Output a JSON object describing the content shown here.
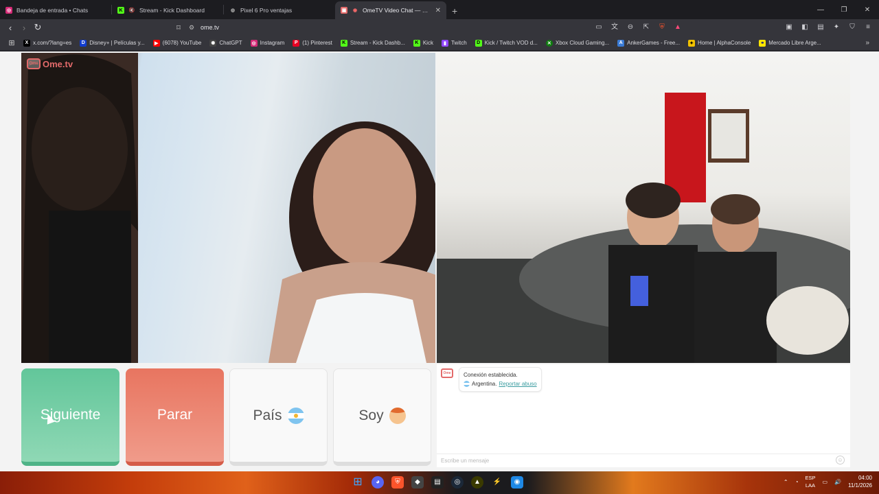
{
  "browser": {
    "tabs": [
      {
        "title": "Bandeja de entrada • Chats",
        "icon": "instagram-icon",
        "color": "#d62976",
        "active": false
      },
      {
        "title": "Stream - Kick Dashboard",
        "icon": "kick-icon",
        "color": "#53fc18",
        "active": false
      },
      {
        "title": "Pixel 6 Pro ventajas",
        "icon": "globe-icon",
        "color": "#888888",
        "active": false
      },
      {
        "title": "OmeTV Video Chat — Omeg",
        "icon": "ometv-icon",
        "color": "#e36a6a",
        "active": true
      }
    ],
    "url": "ome.tv",
    "bookmarks": [
      {
        "label": "x.com/?lang=es",
        "icon": "x-icon",
        "color": "#000000"
      },
      {
        "label": "Disney+ | Películas y...",
        "icon": "disney-icon",
        "color": "#113ccf"
      },
      {
        "label": "(6078) YouTube",
        "icon": "youtube-icon",
        "color": "#ff0000"
      },
      {
        "label": "ChatGPT",
        "icon": "chatgpt-icon",
        "color": "#444444"
      },
      {
        "label": "Instagram",
        "icon": "instagram-icon",
        "color": "#d62976"
      },
      {
        "label": "(1) Pinterest",
        "icon": "pinterest-icon",
        "color": "#e60023"
      },
      {
        "label": "Stream - Kick Dashb...",
        "icon": "kick-icon",
        "color": "#53fc18"
      },
      {
        "label": "Kick",
        "icon": "kick-icon",
        "color": "#53fc18"
      },
      {
        "label": "Twitch",
        "icon": "twitch-icon",
        "color": "#9146ff"
      },
      {
        "label": "Kick / Twitch VOD d...",
        "icon": "kick-icon",
        "color": "#53fc18"
      },
      {
        "label": "Xbox Cloud Gaming...",
        "icon": "xbox-icon",
        "color": "#107c10"
      },
      {
        "label": "AnkerGames - Free...",
        "icon": "anker-icon",
        "color": "#3a7bd5"
      },
      {
        "label": "Home | AlphaConsole",
        "icon": "alpha-icon",
        "color": "#f2c200"
      },
      {
        "label": "Mercado Libre Arge...",
        "icon": "mercadolibre-icon",
        "color": "#ffe600"
      }
    ]
  },
  "page": {
    "logo": "Ome.tv",
    "buttons": {
      "next": "Siguiente",
      "stop": "Parar",
      "country": "País",
      "gender": "Soy"
    },
    "chat": {
      "line1": "Conexión establecida.",
      "country": "Argentina.",
      "report": "Reportar abuso",
      "placeholder": "Escribe un mensaje"
    }
  },
  "taskbar": {
    "lang": "ESP",
    "layout": "LAA",
    "time": "04:00",
    "date": "11/1/2026"
  }
}
